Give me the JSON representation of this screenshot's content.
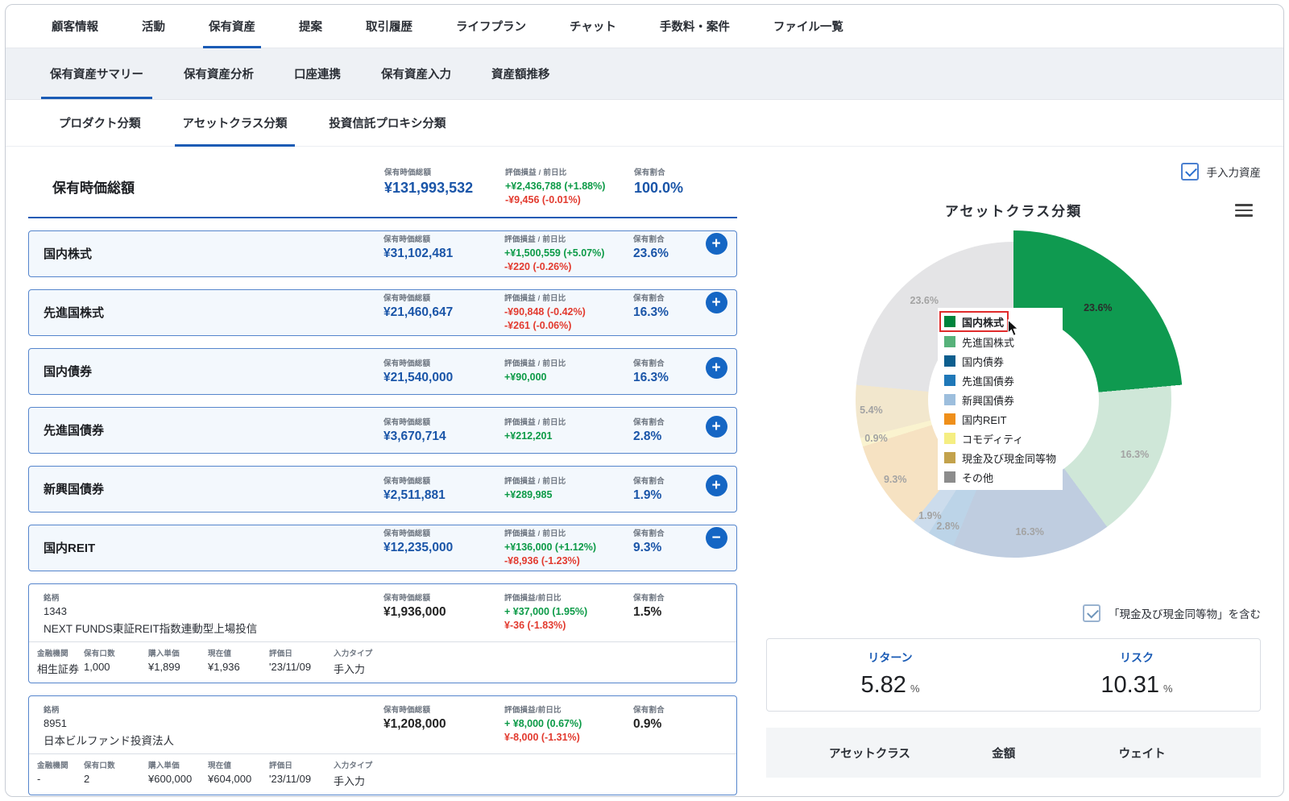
{
  "nav": {
    "tabs": [
      "顧客情報",
      "活動",
      "保有資産",
      "提案",
      "取引履歴",
      "ライフプラン",
      "チャット",
      "手数料・案件",
      "ファイル一覧"
    ],
    "active": "保有資産"
  },
  "subnav": {
    "tabs": [
      "保有資産サマリー",
      "保有資産分析",
      "口座連携",
      "保有資産入力",
      "資産額推移"
    ],
    "active": "保有資産サマリー"
  },
  "classnav": {
    "tabs": [
      "プロダクト分類",
      "アセットクラス分類",
      "投資信託プロキシ分類"
    ],
    "active": "アセットクラス分類"
  },
  "labels": {
    "market_value": "保有時価総額",
    "pl_daily": "評価損益 / 前日比",
    "pl_daily2": "評価損益/前日比",
    "ratio": "保有割合",
    "brand": "銘柄",
    "institution": "金融機関",
    "units": "保有口数",
    "purchase_price": "購入単価",
    "current_price": "現在値",
    "valuation_date": "評価日",
    "input_type": "入力タイプ"
  },
  "summary": {
    "title": "保有時価総額",
    "total": "¥131,993,532",
    "pl": [
      {
        "text": "+¥2,436,788 (+1.88%)",
        "color": "#0c9a47"
      },
      {
        "text": "-¥9,456 (-0.01%)",
        "color": "#e23a2e"
      }
    ],
    "ratio": "100.0%"
  },
  "asset_rows": [
    {
      "name": "国内株式",
      "value": "¥31,102,481",
      "pl": [
        {
          "text": "+¥1,500,559 (+5.07%)",
          "color": "#0c9a47"
        },
        {
          "text": "-¥220 (-0.26%)",
          "color": "#e23a2e"
        }
      ],
      "ratio": "23.6%",
      "button": "+"
    },
    {
      "name": "先進国株式",
      "value": "¥21,460,647",
      "pl": [
        {
          "text": "-¥90,848 (-0.42%)",
          "color": "#e23a2e"
        },
        {
          "text": "-¥261 (-0.06%)",
          "color": "#e23a2e"
        }
      ],
      "ratio": "16.3%",
      "button": "+"
    },
    {
      "name": "国内債券",
      "value": "¥21,540,000",
      "pl": [
        {
          "text": "+¥90,000",
          "color": "#0c9a47"
        }
      ],
      "ratio": "16.3%",
      "button": "+"
    },
    {
      "name": "先進国債券",
      "value": "¥3,670,714",
      "pl": [
        {
          "text": "+¥212,201",
          "color": "#0c9a47"
        }
      ],
      "ratio": "2.8%",
      "button": "+"
    },
    {
      "name": "新興国債券",
      "value": "¥2,511,881",
      "pl": [
        {
          "text": "+¥289,985",
          "color": "#0c9a47"
        }
      ],
      "ratio": "1.9%",
      "button": "+"
    },
    {
      "name": "国内REIT",
      "value": "¥12,235,000",
      "pl": [
        {
          "text": "+¥136,000 (+1.12%)",
          "color": "#0c9a47"
        },
        {
          "text": "-¥8,936 (-1.23%)",
          "color": "#e23a2e"
        }
      ],
      "ratio": "9.3%",
      "button": "−"
    }
  ],
  "holdings": [
    {
      "code": "1343",
      "name": "NEXT FUNDS東証REIT指数連動型上場投信",
      "value": "¥1,936,000",
      "pl": [
        {
          "text": "+ ¥37,000 (1.95%)",
          "color": "#0c9a47"
        },
        {
          "text": "¥-36 (-1.83%)",
          "color": "#e23a2e"
        }
      ],
      "ratio": "1.5%",
      "institution": "相生証券",
      "units": "1,000",
      "purchase_price": "¥1,899",
      "current_price": "¥1,936",
      "valuation_date": "'23/11/09",
      "input_type": "手入力"
    },
    {
      "code": "8951",
      "name": "日本ビルファンド投資法人",
      "value": "¥1,208,000",
      "pl": [
        {
          "text": "+ ¥8,000 (0.67%)",
          "color": "#0c9a47"
        },
        {
          "text": "¥-8,000 (-1.31%)",
          "color": "#e23a2e"
        }
      ],
      "ratio": "0.9%",
      "institution": "-",
      "units": "2",
      "purchase_price": "¥600,000",
      "current_price": "¥604,000",
      "valuation_date": "'23/11/09",
      "input_type": "手入力"
    }
  ],
  "right_panel": {
    "manual_assets_label": "手入力資産",
    "include_cash_label": "「現金及び現金同等物」を含む",
    "return_label": "リターン",
    "return_value": "5.82",
    "risk_label": "リスク",
    "risk_value": "10.31",
    "percent_suffix": "%",
    "table_headers": [
      "アセットクラス",
      "金額",
      "ウェイト"
    ]
  },
  "chart_data": {
    "type": "pie",
    "donut": true,
    "title": "アセットクラス分類",
    "labels": [
      "国内株式",
      "先進国株式",
      "国内債券",
      "先進国債券",
      "新興国債券",
      "国内REIT",
      "コモディティ",
      "現金及び現金同等物",
      "その他"
    ],
    "values": [
      23.6,
      16.3,
      16.3,
      2.8,
      1.9,
      9.3,
      0.9,
      5.4,
      23.6
    ],
    "value_labels": [
      "23.6%",
      "16.3%",
      "16.3%",
      "2.8%",
      "1.9%",
      "9.3%",
      "0.9%",
      "5.4%",
      "23.6%"
    ],
    "colors": [
      "#00843c",
      "#57b27a",
      "#0d5e8e",
      "#1f78b8",
      "#9dbedd",
      "#ef8f1a",
      "#f5ee82",
      "#c3a24c",
      "#8c8c8c"
    ],
    "muted_colors": [
      "#0f9a50",
      "#cfe7d8",
      "#bfcde0",
      "#bcd4e8",
      "#ccdcec",
      "#f6e2c2",
      "#faf3cf",
      "#f2e7cd",
      "#e4e4e6"
    ],
    "highlight_index": 0,
    "highlight_color": "#0f9a50",
    "legend_position": "center-overlay",
    "hovered_legend_item": "国内株式"
  }
}
